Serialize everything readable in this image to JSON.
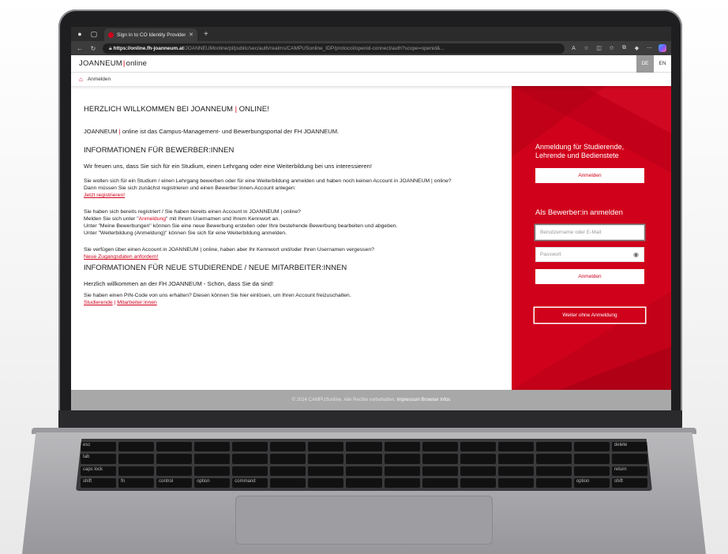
{
  "browser": {
    "tab_title": "Sign in to CO Identity Provider",
    "url_host": "https://online.fh-joanneum.at",
    "url_path": "/JOANNEUMonline/pl/public/sec/auth/realms/CAMPUSonline_IDP/protocol/openid-connect/auth?scope=openid&..."
  },
  "header": {
    "logo_left": "JOANNEUM",
    "logo_right": "online",
    "lang_de": "DE",
    "lang_en": "EN"
  },
  "breadcrumb": {
    "label": "Anmelden"
  },
  "main": {
    "welcome_a": "HERZLICH WILLKOMMEN BEI JOANNEUM ",
    "welcome_b": "ONLINE!",
    "intro_a": "JOANNEUM ",
    "intro_b": "online ist das Campus-Management- und Bewerbungsportal der FH JOANNEUM.",
    "applicants_heading": "INFORMATIONEN FÜR BEWERBER:INNEN",
    "applicants_lead": "Wir freuen uns, dass Sie sich für ein Studium, einen Lehrgang oder eine Weiterbildung bei uns interessieren!",
    "apply_line1": "Sie wollen sich für ein Studium / einen Lehrgang bewerben oder für eine Weiterbildung anmelden und haben noch keinen Account in JOANNEUM | online?",
    "apply_line2": "Dann müssen Sie sich zunächst registrieren und einen Bewerber:innen-Account anlegen:",
    "register_link": "Jetzt registrieren!",
    "registered_line1": "Sie haben sich bereits registriert / Sie haben bereits einen Account in JOANNEUM | online?",
    "registered_line2_a": "Melden Sie sich unter \"",
    "registered_line2_link": "Anmeldung",
    "registered_line2_b": "\" mit Ihrem Usernamen und Ihrem Kennwort an.",
    "registered_line3": "Unter \"Meine Bewerbungen\" können Sie eine neue Bewerbung erstellen oder Ihre bestehende Bewerbung bearbeiten und abgeben.",
    "registered_line4": "Unter \"Weiterbildung (Anmeldung)\" können Sie sich für eine Weiterbildung anmelden.",
    "forgot_line": "Sie verfügen über einen Account in JOANNEUM | online, haben aber Ihr Kennwort und/oder Ihren Usernamen vergessen?",
    "forgot_link": "Neue Zugangsdaten anfordern!",
    "new_heading": "INFORMATIONEN FÜR NEUE STUDIERENDE / NEUE MITARBEITER:INNEN",
    "new_lead": "Herzlich willkommen an der FH JOANNEUM - Schön, dass Sie da sind!",
    "pin_line": "Sie haben einen PIN-Code von uns erhalten? Diesen können Sie hier einlösen, um Ihren Account freizuschalten.",
    "students_link": "Studierende",
    "separator": " | ",
    "staff_link": "Mitarbeiter:innen"
  },
  "login": {
    "staff_heading": "Anmeldung für Studierende, Lehrende und Bedienstete",
    "staff_button": "Anmelden",
    "applicant_heading": "Als Bewerber:in anmelden",
    "username_placeholder": "Benutzername oder E-Mail",
    "password_placeholder": "Passwort",
    "applicant_button": "Anmelden",
    "guest_button": "Weiter ohne Anmeldung"
  },
  "footer": {
    "copyright": "© 2024 CAMPUSonline. Alle Rechte vorbehalten.",
    "impressum": "Impressum",
    "browser_info": "Browser Infos"
  },
  "keyboard": {
    "keys": [
      "esc",
      "tab",
      "caps lock",
      "shift",
      "fn",
      "control",
      "option",
      "command",
      "delete",
      "return",
      "shift",
      "option"
    ]
  },
  "colors": {
    "brand_red": "#d0021b",
    "footer_gray": "#a8a8a8"
  }
}
